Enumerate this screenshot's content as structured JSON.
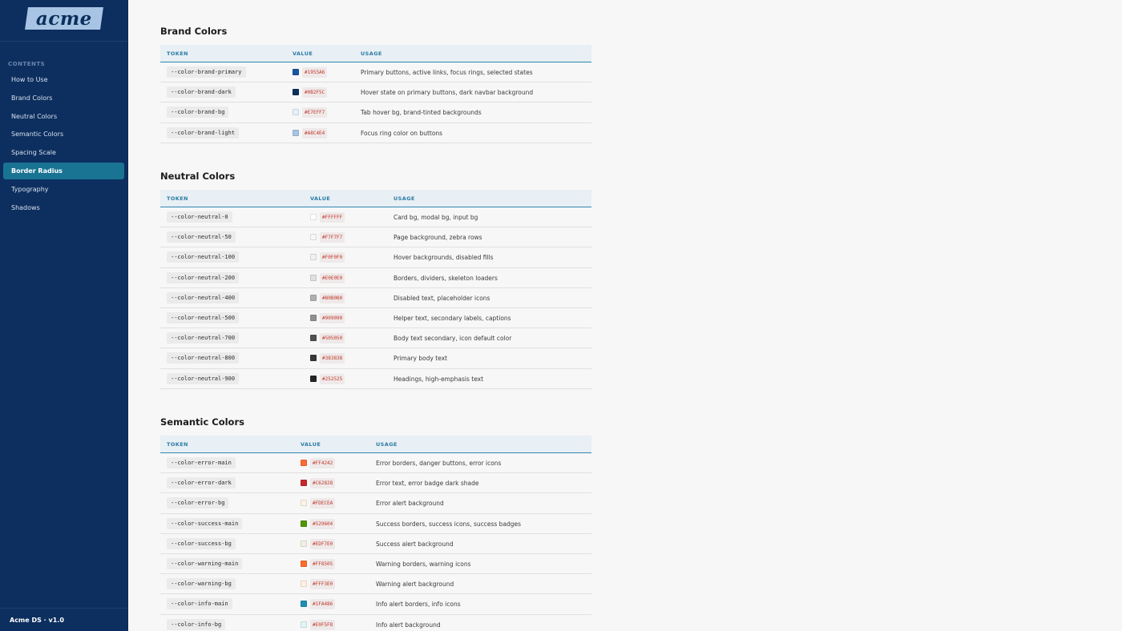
{
  "sidebar": {
    "logo_text": "acme",
    "contents_label": "CONTENTS",
    "items": [
      {
        "label": "How to Use",
        "active": false
      },
      {
        "label": "Brand Colors",
        "active": false
      },
      {
        "label": "Neutral Colors",
        "active": false
      },
      {
        "label": "Semantic Colors",
        "active": false
      },
      {
        "label": "Spacing Scale",
        "active": false
      },
      {
        "label": "Border Radius",
        "active": true
      },
      {
        "label": "Typography",
        "active": false
      },
      {
        "label": "Shadows",
        "active": false
      }
    ],
    "footer": "Acme DS · v1.0"
  },
  "sections": [
    {
      "id": "brand",
      "title": "Brand Colors",
      "headers": {
        "token": "TOKEN",
        "value": "VALUE",
        "usage": "USAGE"
      },
      "rows": [
        {
          "token": "--color-brand-primary",
          "value": "#1955A6",
          "color": "#1955A6",
          "usage": "Primary buttons, active links, focus rings, selected states"
        },
        {
          "token": "--color-brand-dark",
          "value": "#0B2F5C",
          "color": "#0B2F5C",
          "usage": "Hover state on primary buttons, dark navbar background"
        },
        {
          "token": "--color-brand-bg",
          "value": "#E7EFF7",
          "color": "#E7EFF7",
          "usage": "Tab hover bg, brand-tinted backgrounds"
        },
        {
          "token": "--color-brand-light",
          "value": "#A8C4E4",
          "color": "#A8C4E4",
          "usage": "Focus ring color on buttons"
        }
      ]
    },
    {
      "id": "neutral",
      "title": "Neutral Colors",
      "headers": {
        "token": "TOKEN",
        "value": "VALUE",
        "usage": "USAGE"
      },
      "rows": [
        {
          "token": "--color-neutral-0",
          "value": "#FFFFFF",
          "color": "#FFFFFF",
          "usage": "Card bg, modal bg, input bg"
        },
        {
          "token": "--color-neutral-50",
          "value": "#F7F7F7",
          "color": "#F7F7F7",
          "usage": "Page background, zebra rows"
        },
        {
          "token": "--color-neutral-100",
          "value": "#F0F0F0",
          "color": "#F0F0F0",
          "usage": "Hover backgrounds, disabled fills"
        },
        {
          "token": "--color-neutral-200",
          "value": "#E0E0E0",
          "color": "#E0E0E0",
          "usage": "Borders, dividers, skeleton loaders"
        },
        {
          "token": "--color-neutral-400",
          "value": "#B0B0B0",
          "color": "#B0B0B0",
          "usage": "Disabled text, placeholder icons"
        },
        {
          "token": "--color-neutral-500",
          "value": "#909090",
          "color": "#909090",
          "usage": "Helper text, secondary labels, captions"
        },
        {
          "token": "--color-neutral-700",
          "value": "#505050",
          "color": "#505050",
          "usage": "Body text secondary, icon default color"
        },
        {
          "token": "--color-neutral-800",
          "value": "#383838",
          "color": "#383838",
          "usage": "Primary body text"
        },
        {
          "token": "--color-neutral-900",
          "value": "#252525",
          "color": "#252525",
          "usage": "Headings, high-emphasis text"
        }
      ]
    },
    {
      "id": "semantic",
      "title": "Semantic Colors",
      "headers": {
        "token": "TOKEN",
        "value": "VALUE",
        "usage": "USAGE"
      },
      "rows": [
        {
          "token": "--color-error-main",
          "value": "#FF4242",
          "color": "#FF6B35",
          "usage": "Error borders, danger buttons, error icons"
        },
        {
          "token": "--color-error-dark",
          "value": "#C62828",
          "color": "#C62828",
          "usage": "Error text, error badge dark shade"
        },
        {
          "token": "--color-error-bg",
          "value": "#FDECEA",
          "color": "#FDF3E7",
          "usage": "Error alert background"
        },
        {
          "token": "--color-success-main",
          "value": "#529604",
          "color": "#529604",
          "usage": "Success borders, success icons, success badges"
        },
        {
          "token": "--color-success-bg",
          "value": "#EDF7E0",
          "color": "#F5EEE4",
          "usage": "Success alert background"
        },
        {
          "token": "--color-warning-main",
          "value": "#FF8505",
          "color": "#FF6B2C",
          "usage": "Warning borders, warning icons"
        },
        {
          "token": "--color-warning-bg",
          "value": "#FFF3E0",
          "color": "#FFF3E0",
          "usage": "Warning alert background"
        },
        {
          "token": "--color-info-main",
          "value": "#1FA486",
          "color": "#1F8FB4",
          "usage": "Info alert borders, info icons"
        },
        {
          "token": "--color-info-bg",
          "value": "#E0F5F8",
          "color": "#E0F5F8",
          "usage": "Info alert background"
        }
      ]
    }
  ]
}
